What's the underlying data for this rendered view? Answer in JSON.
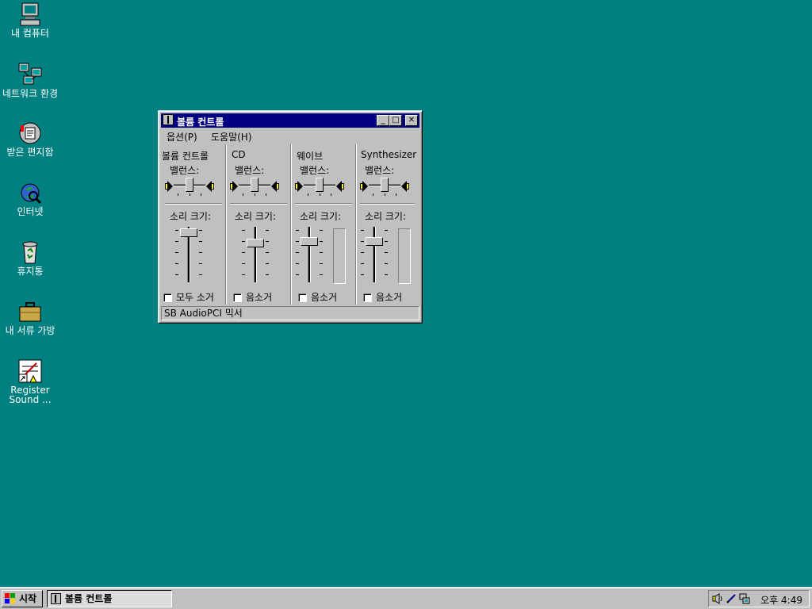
{
  "desktop": {
    "icons": [
      {
        "label": "내 컴퓨터",
        "icon": "my-computer-icon"
      },
      {
        "label": "네트워크 환경",
        "icon": "network-neighborhood-icon"
      },
      {
        "label": "받은 편지함",
        "icon": "inbox-icon"
      },
      {
        "label": "인터넷",
        "icon": "internet-explorer-icon"
      },
      {
        "label": "휴지통",
        "icon": "recycle-bin-icon"
      },
      {
        "label": "내 서류 가방",
        "icon": "briefcase-icon"
      },
      {
        "label": "Register Sound ...",
        "icon": "register-shortcut-icon"
      }
    ]
  },
  "window": {
    "title": "볼륨 컨트롤",
    "menu": [
      "옵션(P)",
      "도움말(H)"
    ],
    "balance_label": "밸런스:",
    "volume_label": "소리 크기:",
    "columns": [
      {
        "name": "볼륨 컨트롤",
        "checkbox": "모두 소거",
        "checked": false,
        "volume": 0.95,
        "balance": 0.5,
        "meter": false
      },
      {
        "name": "CD",
        "checkbox": "음소거",
        "checked": false,
        "volume": 0.75,
        "balance": 0.5,
        "meter": false
      },
      {
        "name": "웨이브",
        "checkbox": "음소거",
        "checked": false,
        "volume": 0.75,
        "balance": 0.5,
        "meter": true
      },
      {
        "name": "Synthesizer",
        "checkbox": "음소거",
        "checked": false,
        "volume": 0.75,
        "balance": 0.5,
        "meter": true
      }
    ],
    "status": "SB AudioPCI 믹서",
    "title_buttons": {
      "minimize": "_",
      "maximize": "□",
      "close": "✕"
    }
  },
  "taskbar": {
    "start_label": "시작",
    "task_button": "볼륨 컨트롤",
    "tray_icons": [
      "speaker-icon",
      "pen-icon",
      "network-icon"
    ],
    "clock": "오후 4:49"
  },
  "colors": {
    "desktop": "#008080",
    "title": "#000080",
    "face": "#c0c0c0"
  }
}
